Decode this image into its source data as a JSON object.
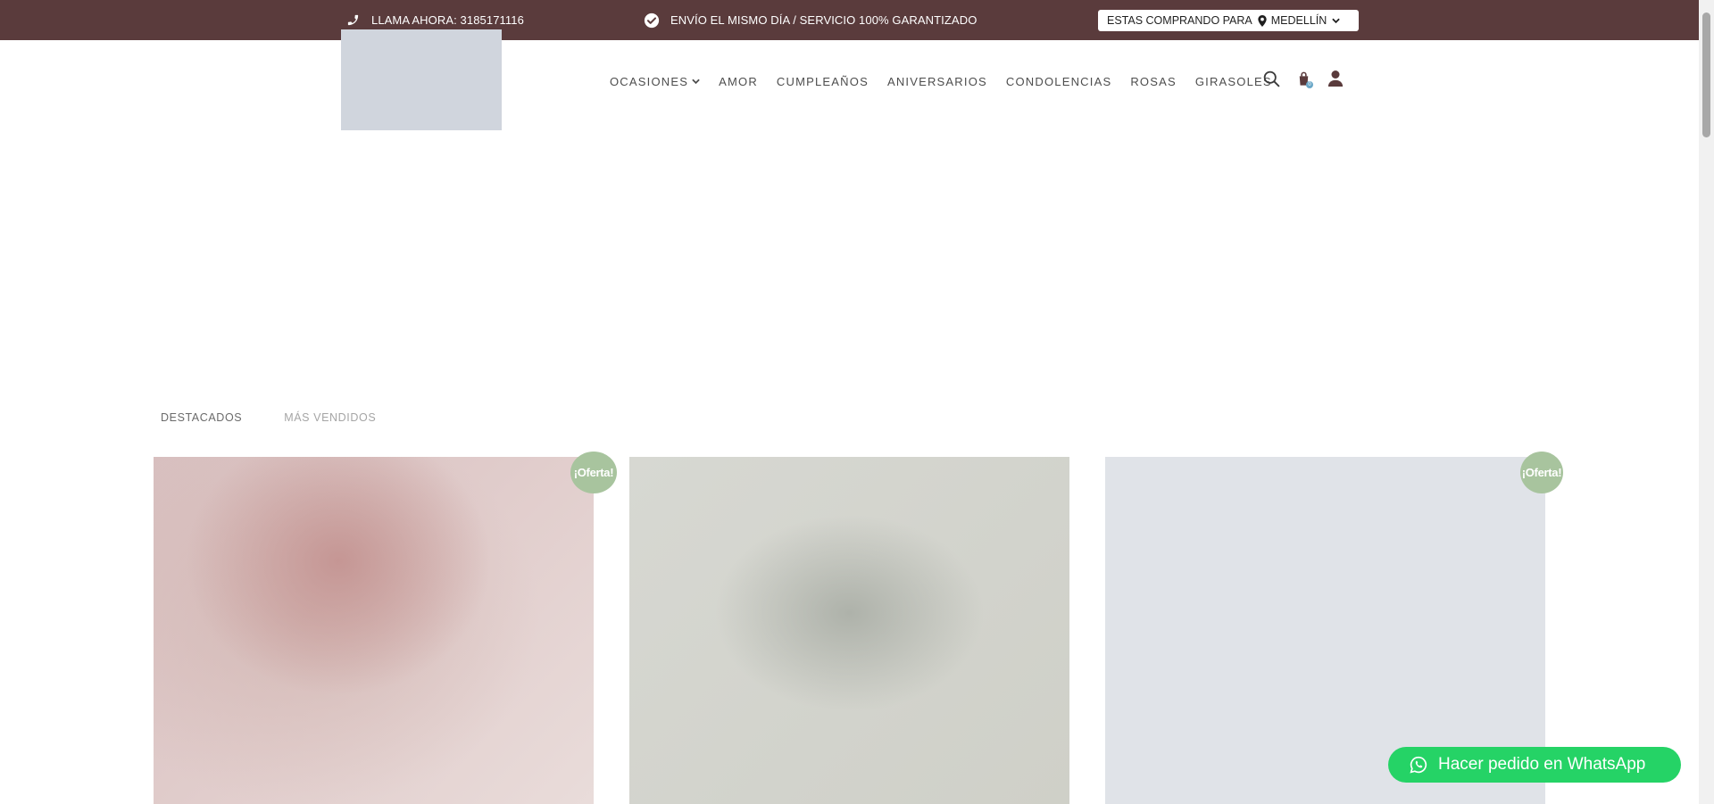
{
  "topbar": {
    "phone_text": "LLAMA AHORA: 3185171116",
    "shipping_text": "ENVÍO EL MISMO DÍA / SERVICIO 100% GARANTIZADO",
    "city_prefix": "ESTAS COMPRANDO PARA",
    "city_value": "MEDELLÍN",
    "background_color": "#5a3b3c"
  },
  "nav": {
    "items": [
      {
        "label": "OCASIONES",
        "has_dropdown": true
      },
      {
        "label": "AMOR"
      },
      {
        "label": "CUMPLEAÑOS"
      },
      {
        "label": "ANIVERSARIOS"
      },
      {
        "label": "CONDOLENCIAS"
      },
      {
        "label": "ROSAS"
      },
      {
        "label": "GIRASOLES"
      }
    ],
    "icons": [
      "search-icon",
      "shopping-bag-icon",
      "user-icon"
    ],
    "cart_count": "0"
  },
  "tabs": [
    {
      "label": "DESTACADOS",
      "active": true
    },
    {
      "label": "MÁS VENDIDOS",
      "active": false
    }
  ],
  "products": {
    "badge_label": "¡Oferta!",
    "badge_color": "#a8c49e"
  },
  "whatsapp": {
    "label": "Hacer pedido en WhatsApp",
    "color": "#25d366"
  }
}
